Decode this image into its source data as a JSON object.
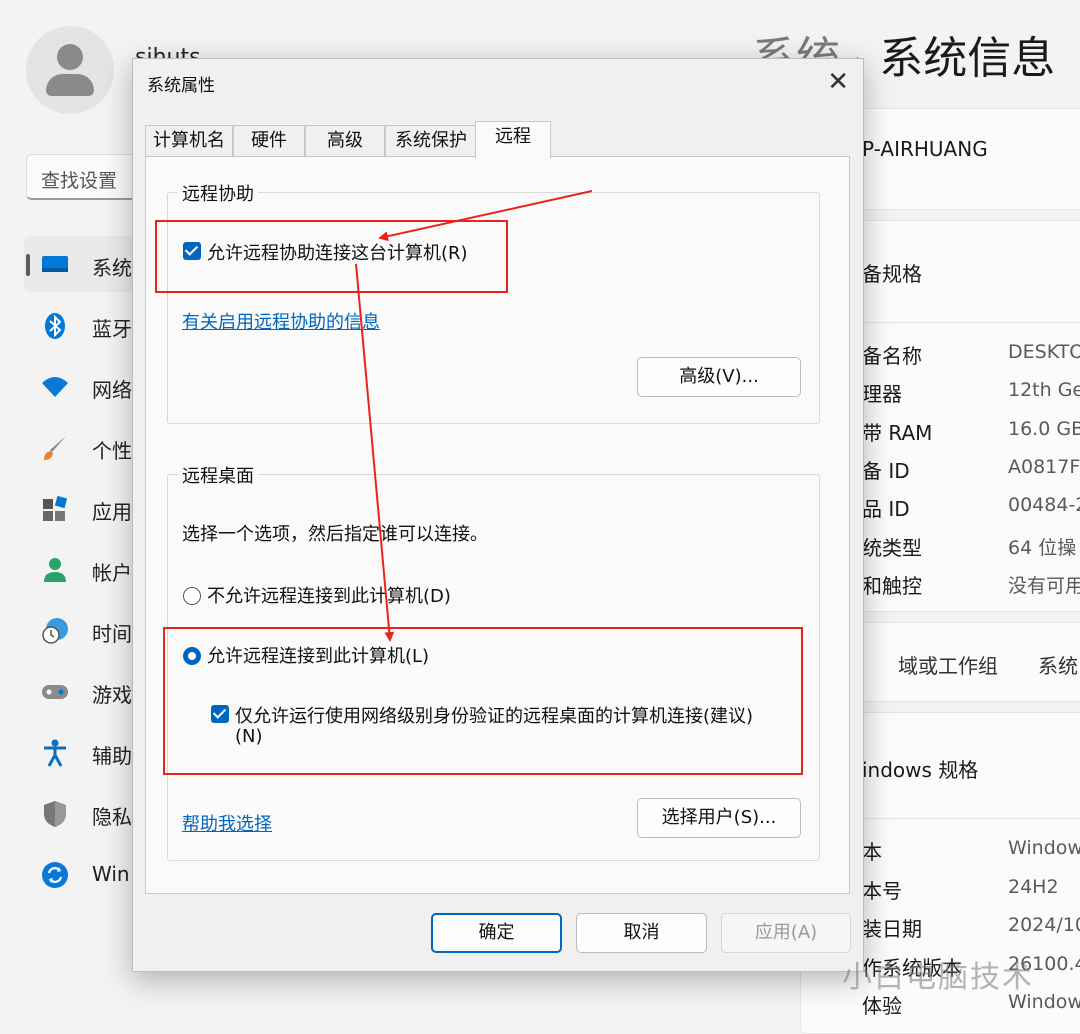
{
  "settings": {
    "username": "sihuts",
    "search_placeholder": "查找设置",
    "nav": [
      {
        "label": "系统",
        "icon": "system-icon"
      },
      {
        "label": "蓝牙",
        "icon": "bluetooth-icon"
      },
      {
        "label": "网络",
        "icon": "wifi-icon"
      },
      {
        "label": "个性",
        "icon": "brush-icon"
      },
      {
        "label": "应用",
        "icon": "apps-icon"
      },
      {
        "label": "帐户",
        "icon": "account-icon"
      },
      {
        "label": "时间",
        "icon": "clock-icon"
      },
      {
        "label": "游戏",
        "icon": "gamepad-icon"
      },
      {
        "label": "辅助",
        "icon": "accessibility-icon"
      },
      {
        "label": "隐私",
        "icon": "shield-icon"
      },
      {
        "label": "Win",
        "icon": "update-icon"
      }
    ],
    "breadcrumb_parent": "系统",
    "breadcrumb_sep": "›",
    "breadcrumb_current": "系统信息",
    "device_name": "P-AIRHUANG",
    "spec_heading": "备规格",
    "spec_rows": [
      {
        "label": "备名称",
        "value": "DESKTO"
      },
      {
        "label": "理器",
        "value": "12th Ge"
      },
      {
        "label": "带 RAM",
        "value": "16.0 GB"
      },
      {
        "label": "备 ID",
        "value": "A0817F1"
      },
      {
        "label": "品 ID",
        "value": "00484-2"
      },
      {
        "label": "统类型",
        "value": "64 位操"
      },
      {
        "label": "和触控",
        "value": "没有可用"
      }
    ],
    "links": [
      "域或工作组",
      "系统"
    ],
    "win_heading": "indows 规格",
    "win_rows": [
      {
        "label": "本",
        "value": "Window"
      },
      {
        "label": "本号",
        "value": "24H2"
      },
      {
        "label": "装日期",
        "value": "2024/10"
      },
      {
        "label": "作系统版本",
        "value": "26100.4"
      },
      {
        "label": "体验",
        "value": "Window"
      }
    ],
    "watermark": "小白电脑技术"
  },
  "dialog": {
    "title": "系统属性",
    "close": "✕",
    "tabs": [
      "计算机名",
      "硬件",
      "高级",
      "系统保护",
      "远程"
    ],
    "remote_assistance": {
      "title": "远程协助",
      "checkbox_label": "允许远程协助连接这台计算机(R)",
      "info_link": "有关启用远程协助的信息",
      "advanced_button": "高级(V)..."
    },
    "remote_desktop": {
      "title": "远程桌面",
      "instruction": "选择一个选项，然后指定谁可以连接。",
      "option_deny": "不允许远程连接到此计算机(D)",
      "option_allow": "允许远程连接到此计算机(L)",
      "nla_line1": "仅允许运行使用网络级别身份验证的远程桌面的计算机连接(建议)",
      "nla_line2": "(N)",
      "help_link": "帮助我选择",
      "select_users_button": "选择用户(S)..."
    },
    "buttons": {
      "ok": "确定",
      "cancel": "取消",
      "apply": "应用(A)"
    }
  },
  "annotation_color": "#e8241c",
  "accent_color": "#0067c0"
}
